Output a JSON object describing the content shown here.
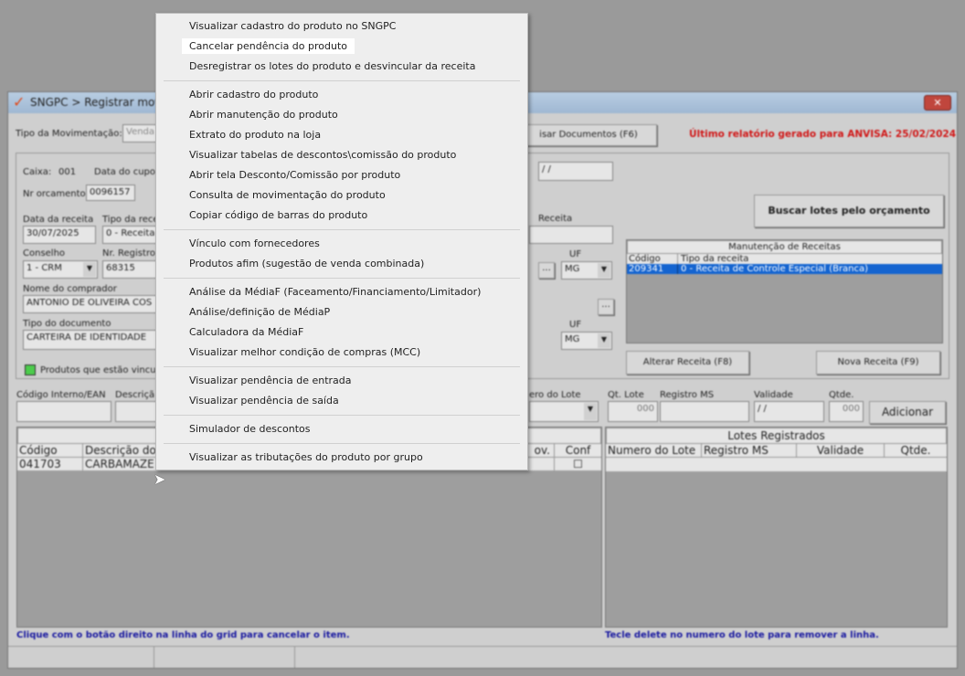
{
  "window": {
    "title": "SNGPC > Registrar movim",
    "close": "✕"
  },
  "header": {
    "tipo_mov_label": "Tipo da Movimentação:",
    "tipo_mov_value": "Venda",
    "pesquisar_button": "isar Documentos (F6)",
    "anvisa_text": "Último relatório gerado para ANVISA: 25/02/2024"
  },
  "form": {
    "caixa_label": "Caixa:",
    "caixa_value": "001",
    "data_cupom_label": "Data do cupo",
    "data_cupom_value": "/ /",
    "nr_orc_label": "Nr orcamento:",
    "nr_orc_value": "0096157",
    "data_receita_label": "Data da receita",
    "data_receita_value": "30/07/2025",
    "tipo_receita_label": "Tipo da rece",
    "tipo_receita_value": "0 - Receita",
    "conselho_label": "Conselho",
    "conselho_value": "1 - CRM",
    "nr_registro_label": "Nr. Registro",
    "nr_registro_value": "68315",
    "nome_label": "Nome do comprador",
    "nome_value": "ANTONIO DE OLIVEIRA COS",
    "tipo_doc_label": "Tipo do documento",
    "tipo_doc_value": "CARTEIRA DE IDENTIDADE",
    "receita_label": "Receita",
    "uf_label": "UF",
    "uf_value": "MG",
    "uf2_label": "UF",
    "uf2_value": "MG",
    "ellipsis": "...",
    "legend_text": "Produtos que estão vincul"
  },
  "buscar_button": "Buscar lotes pelo orçamento",
  "receitas": {
    "title": "Manutenção de Receitas",
    "columns": [
      "Código",
      "Tipo da receita"
    ],
    "rows": [
      {
        "codigo": "209341",
        "tipo": "0 - Receita de Controle Especial (Branca)"
      }
    ]
  },
  "alterar_button": "Alterar Receita (F8)",
  "nova_button": "Nova Receita (F9)",
  "item_entry": {
    "codigo_label": "Código Interno/EAN",
    "descricao_label": "Descriçã",
    "lote_label": "ero do Lote",
    "qt_lote_label": "Qt. Lote",
    "qt_lote_value": "000",
    "registro_label": "Registro MS",
    "validade_label": "Validade",
    "validade_value": "/ /",
    "qtde_label": "Qtde.",
    "qtde_value": "000",
    "adicionar_button": "Adicionar"
  },
  "items_grid": {
    "columns": [
      "Código",
      "Descrição do",
      "ov.",
      "Conf"
    ],
    "rows": [
      {
        "codigo": "041703",
        "descricao": "CARBAMAZE"
      }
    ]
  },
  "lotes_grid": {
    "title": "Lotes Registrados",
    "columns": [
      "Numero do Lote",
      "Registro MS",
      "Validade",
      "Qtde."
    ]
  },
  "footer": {
    "left": "Clique com o botão direito na linha do grid para cancelar o item.",
    "right": "Tecle delete no numero do lote para remover a linha."
  },
  "menu": {
    "groups": [
      [
        "Visualizar cadastro do produto no SNGPC",
        "Cancelar pendência do produto",
        "Desregistrar os lotes do produto e desvincular da receita"
      ],
      [
        "Abrir cadastro do produto",
        "Abrir manutenção do produto",
        "Extrato do produto na loja",
        "Visualizar tabelas de descontos\\comissão do produto",
        "Abrir tela Desconto/Comissão por produto",
        "Consulta de movimentação do produto",
        "Copiar código de barras do produto"
      ],
      [
        "Vínculo com fornecedores",
        "Produtos afim (sugestão de venda combinada)"
      ],
      [
        "Análise da MédiaF (Faceamento/Financiamento/Limitador)",
        "Análise/definição de MédiaP",
        "Calculadora da MédiaF",
        "Visualizar melhor condição de compras (MCC)"
      ],
      [
        "Visualizar pendência de entrada",
        "Visualizar pendência de saída"
      ],
      [
        "Simulador de descontos"
      ],
      [
        "Visualizar as tributações do produto por grupo"
      ]
    ],
    "highlighted": "Cancelar pendência do produto"
  }
}
